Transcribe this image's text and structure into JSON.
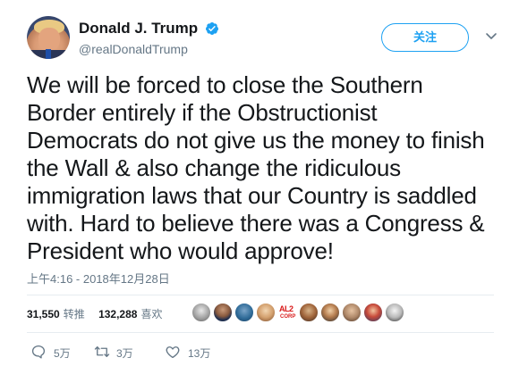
{
  "author": {
    "display_name": "Donald J. Trump",
    "handle": "@realDonaldTrump",
    "verified": true,
    "avatar_icon": "profile-avatar"
  },
  "follow_button": {
    "label": "关注"
  },
  "menu_icon": "chevron-down-icon",
  "tweet_text_lines": [
    "We will be forced to close the Southern",
    "Border entirely if the Obstructionist",
    "Democrats do not give us the money to finish",
    "the Wall & also change the ridiculous",
    "immigration laws that our Country is saddled",
    "with. Hard to believe there was a Congress &",
    "President who would approve!"
  ],
  "timestamp": "上午4:16 - 2018年12月28日",
  "stats": {
    "retweets_count": "31,550",
    "retweets_label": "转推",
    "likes_count": "132,288",
    "likes_label": "喜欢"
  },
  "likers": [
    {
      "name": "liker-avatar-1"
    },
    {
      "name": "liker-avatar-2"
    },
    {
      "name": "liker-avatar-3"
    },
    {
      "name": "liker-avatar-4"
    },
    {
      "name": "liker-avatar-5",
      "text": "AL2",
      "subtext": "CORP"
    },
    {
      "name": "liker-avatar-6"
    },
    {
      "name": "liker-avatar-7"
    },
    {
      "name": "liker-avatar-8"
    },
    {
      "name": "liker-avatar-9"
    },
    {
      "name": "liker-avatar-10"
    }
  ],
  "actions": {
    "reply_count": "5万",
    "retweet_count": "3万",
    "like_count": "13万"
  },
  "colors": {
    "accent": "#1da1f2",
    "secondary_text": "#657786",
    "primary_text": "#14171a",
    "divider": "#e6ecf0"
  }
}
